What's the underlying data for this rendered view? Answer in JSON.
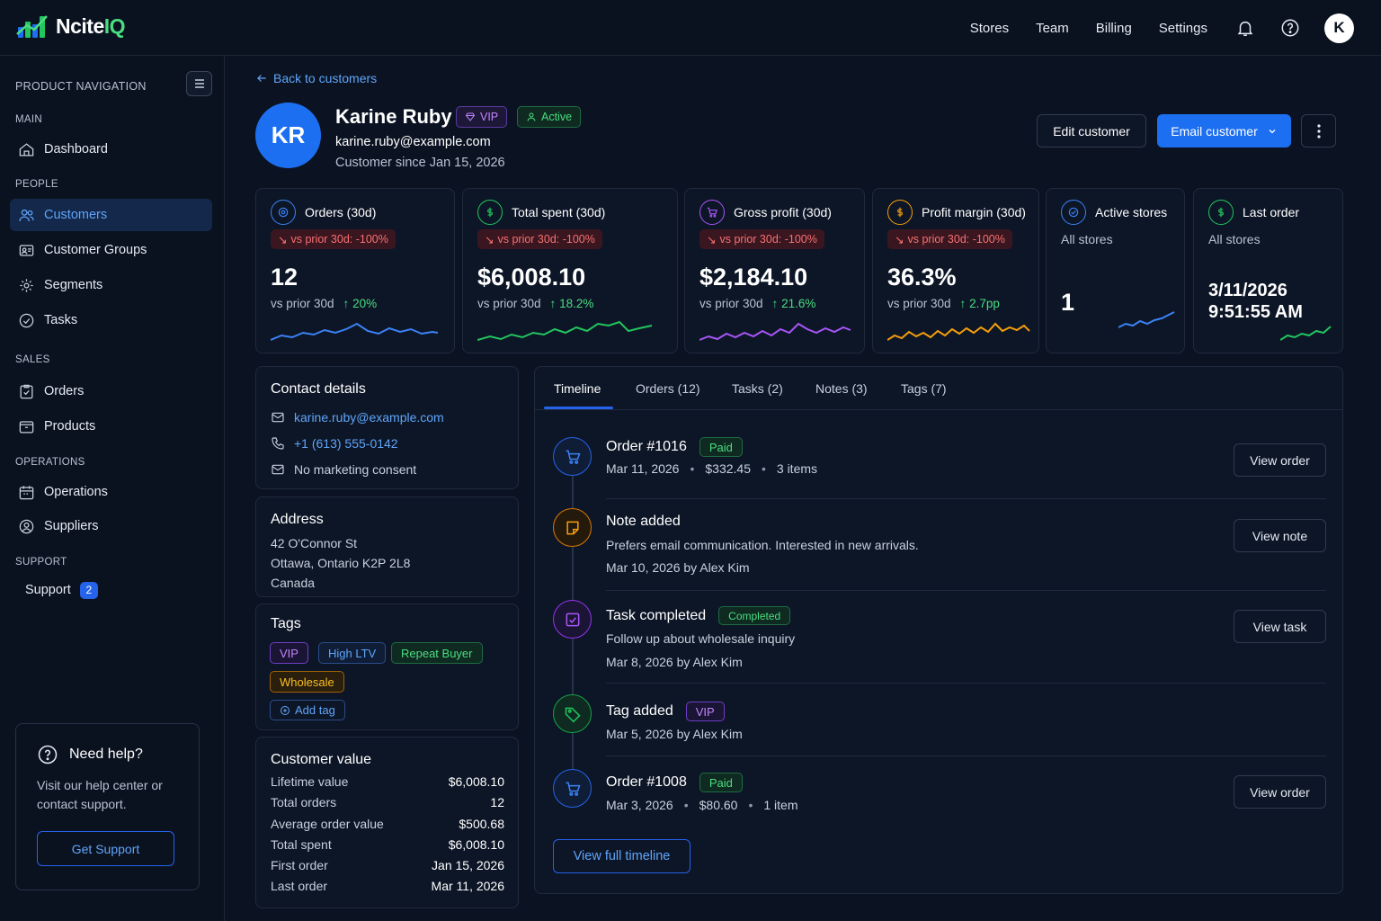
{
  "app": {
    "brand_prefix": "Ncite",
    "brand_suffix": "IQ"
  },
  "topnav": {
    "items": [
      "Stores",
      "Team",
      "Billing",
      "Settings"
    ],
    "avatar_initial": "K"
  },
  "sidebar": {
    "heading": "PRODUCT NAVIGATION",
    "sections": {
      "main": "MAIN",
      "people": "PEOPLE",
      "sales": "SALES",
      "operations": "OPERATIONS",
      "support": "SUPPORT"
    },
    "items": {
      "dashboard": "Dashboard",
      "customers": "Customers",
      "customer_groups": "Customer Groups",
      "segments": "Segments",
      "tasks": "Tasks",
      "orders": "Orders",
      "products": "Products",
      "operations": "Operations",
      "suppliers": "Suppliers",
      "support": "Support"
    },
    "support_badge": "2",
    "help": {
      "title": "Need help?",
      "text": "Visit our help center or contact support.",
      "button": "Get Support"
    }
  },
  "header": {
    "back": "Back to customers",
    "initials": "KR",
    "name": "Karine Ruby",
    "vip": "VIP",
    "status": "Active",
    "email": "karine.ruby@example.com",
    "since": "Customer since Jan 15, 2026",
    "edit_button": "Edit customer",
    "email_button": "Email customer"
  },
  "kpis": [
    {
      "title": "Orders (30d)",
      "change": "vs prior 30d: -100%",
      "value": "12",
      "cmp": "vs prior 30d",
      "delta": "20%",
      "color": "#3b82f6",
      "icon": "orders-icon"
    },
    {
      "title": "Total spent (30d)",
      "change": "vs prior 30d: -100%",
      "value": "$6,008.10",
      "cmp": "vs prior 30d",
      "delta": "18.2%",
      "color": "#22c55e",
      "icon": "dollar-icon"
    },
    {
      "title": "Gross profit (30d)",
      "change": "vs prior 30d: -100%",
      "value": "$2,184.10",
      "cmp": "vs prior 30d",
      "delta": "21.6%",
      "color": "#a855f7",
      "icon": "cart-icon"
    },
    {
      "title": "Profit margin (30d)",
      "change": "vs prior 30d: -100%",
      "value": "36.3%",
      "cmp": "vs prior 30d",
      "delta": "2.7pp",
      "color": "#f59e0b",
      "icon": "percent-icon"
    },
    {
      "title": "Active stores",
      "sub": "All stores",
      "value": "1",
      "color": "#3b82f6",
      "icon": "store-icon"
    },
    {
      "title": "Last order",
      "sub": "All stores",
      "value_line1": "3/11/2026",
      "value_line2": "9:51:55 AM",
      "color": "#22c55e",
      "icon": "clock-icon"
    }
  ],
  "contact": {
    "title": "Contact details",
    "email": "karine.ruby@example.com",
    "phone": "+1 (613) 555-0142",
    "consent": "No marketing consent"
  },
  "address": {
    "title": "Address",
    "line1": "42 O'Connor St",
    "line2": "Ottawa, Ontario K2P 2L8",
    "line3": "Canada"
  },
  "tags": {
    "title": "Tags",
    "items": [
      "VIP",
      "High LTV",
      "Repeat Buyer",
      "Wholesale"
    ],
    "add": "Add tag"
  },
  "customer_value": {
    "title": "Customer value",
    "rows": [
      {
        "label": "Lifetime value",
        "value": "$6,008.10"
      },
      {
        "label": "Total orders",
        "value": "12"
      },
      {
        "label": "Average order value",
        "value": "$500.68"
      },
      {
        "label": "Total spent",
        "value": "$6,008.10"
      },
      {
        "label": "First order",
        "value": "Jan 15, 2026"
      },
      {
        "label": "Last order",
        "value": "Mar 11, 2026"
      }
    ]
  },
  "tabs": [
    "Timeline",
    "Orders (12)",
    "Tasks (2)",
    "Notes (3)",
    "Tags (7)"
  ],
  "timeline": [
    {
      "title": "Order #1016",
      "badge": "Paid",
      "date": "Mar 11, 2026",
      "amount": "$332.45",
      "items": "3 items",
      "button": "View order"
    },
    {
      "title": "Note added",
      "line1": "Prefers email communication. Interested in new arrivals.",
      "line2": "Mar 10, 2026 by Alex Kim",
      "button": "View note"
    },
    {
      "title": "Task completed",
      "badge": "Completed",
      "line1": "Follow up about wholesale inquiry",
      "line2": "Mar 8, 2026 by Alex Kim",
      "button": "View task"
    },
    {
      "title": "Tag added",
      "badge": "VIP",
      "line2": "Mar 5, 2026 by Alex Kim"
    },
    {
      "title": "Order #1008",
      "badge": "Paid",
      "date": "Mar 3, 2026",
      "amount": "$80.60",
      "items": "1 item",
      "button": "View order"
    }
  ],
  "timeline_button": "View full timeline"
}
